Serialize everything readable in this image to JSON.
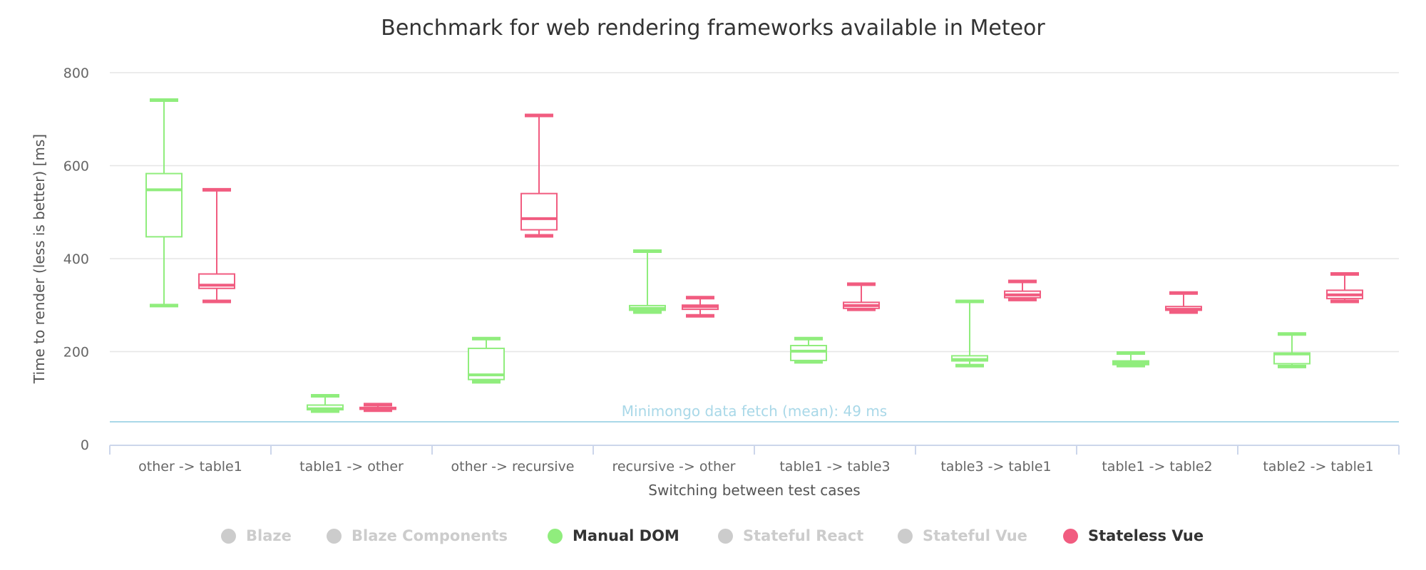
{
  "chart_data": {
    "type": "boxplot",
    "title": "Benchmark for web rendering frameworks available in Meteor",
    "xlabel": "Switching between test cases",
    "ylabel": "Time to render (less is better) [ms]",
    "ylim": [
      0,
      800
    ],
    "yticks": [
      "0",
      "200",
      "400",
      "600",
      "800"
    ],
    "grid": true,
    "legend_position": "bottom",
    "categories": [
      "other -> table1",
      "table1 -> other",
      "other -> recursive",
      "recursive -> other",
      "table1 -> table3",
      "table3 -> table1",
      "table1 -> table2",
      "table2 -> table1"
    ],
    "plot_line": {
      "value": 49,
      "label": "Minimongo data fetch (mean): 49 ms",
      "color": "#a9d8e8"
    },
    "series": [
      {
        "name": "Manual DOM",
        "color": "#90ed7d",
        "visible": true,
        "values": [
          {
            "low": 299,
            "q1": 447,
            "median": 548,
            "q3": 583,
            "high": 741
          },
          {
            "low": 72,
            "q1": 75,
            "median": 77,
            "q3": 85,
            "high": 105
          },
          {
            "low": 135,
            "q1": 140,
            "median": 150,
            "q3": 207,
            "high": 228
          },
          {
            "low": 285,
            "q1": 289,
            "median": 293,
            "q3": 299,
            "high": 416
          },
          {
            "low": 178,
            "q1": 181,
            "median": 201,
            "q3": 213,
            "high": 228
          },
          {
            "low": 170,
            "q1": 180,
            "median": 183,
            "q3": 191,
            "high": 308
          },
          {
            "low": 170,
            "q1": 172,
            "median": 176,
            "q3": 180,
            "high": 197
          },
          {
            "low": 168,
            "q1": 174,
            "median": 195,
            "q3": 197,
            "high": 238
          }
        ]
      },
      {
        "name": "Stateless Vue",
        "color": "#f15c80",
        "visible": true,
        "values": [
          {
            "low": 308,
            "q1": 336,
            "median": 343,
            "q3": 367,
            "high": 548
          },
          {
            "low": 74,
            "q1": 76,
            "median": 78,
            "q3": 80,
            "high": 86
          },
          {
            "low": 449,
            "q1": 462,
            "median": 486,
            "q3": 540,
            "high": 708
          },
          {
            "low": 277,
            "q1": 291,
            "median": 297,
            "q3": 300,
            "high": 316
          },
          {
            "low": 291,
            "q1": 293,
            "median": 299,
            "q3": 306,
            "high": 345
          },
          {
            "low": 312,
            "q1": 316,
            "median": 322,
            "q3": 330,
            "high": 351
          },
          {
            "low": 285,
            "q1": 289,
            "median": 291,
            "q3": 297,
            "high": 326
          },
          {
            "low": 308,
            "q1": 314,
            "median": 322,
            "q3": 332,
            "high": 367
          }
        ]
      }
    ]
  },
  "legend": [
    {
      "name": "Blaze",
      "color": "#cccccc",
      "active": false
    },
    {
      "name": "Blaze Components",
      "color": "#cccccc",
      "active": false
    },
    {
      "name": "Manual DOM",
      "color": "#90ed7d",
      "active": true
    },
    {
      "name": "Stateful React",
      "color": "#cccccc",
      "active": false
    },
    {
      "name": "Stateful Vue",
      "color": "#cccccc",
      "active": false
    },
    {
      "name": "Stateless Vue",
      "color": "#f15c80",
      "active": true
    }
  ]
}
